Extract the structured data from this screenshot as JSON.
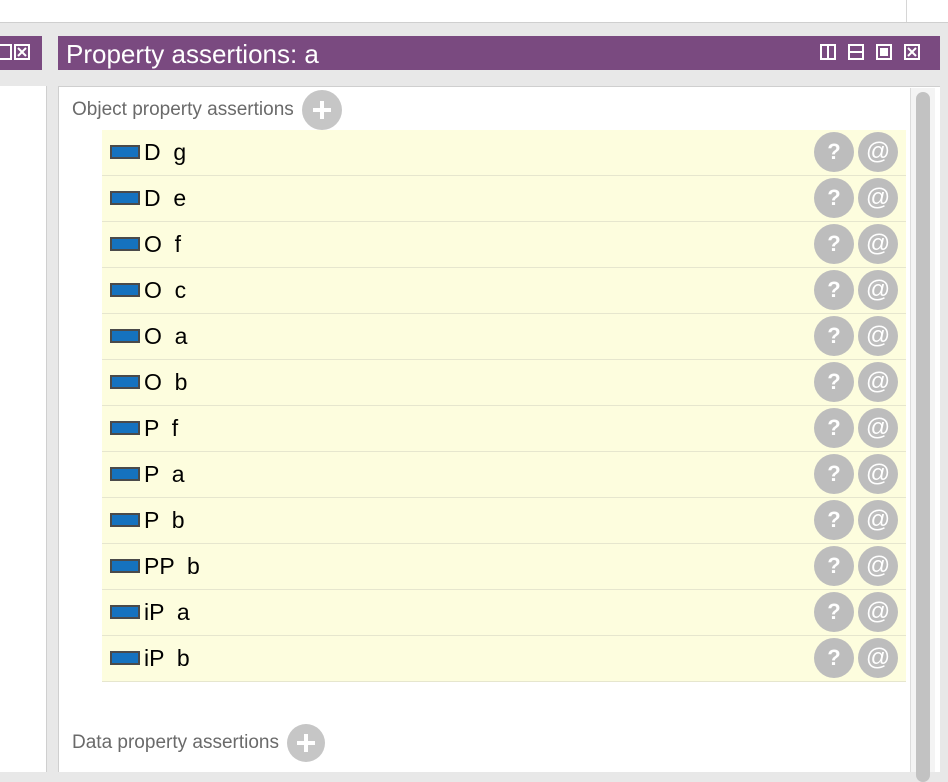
{
  "panel": {
    "title": "Property assertions: a"
  },
  "sections": {
    "object_label": "Object property assertions",
    "data_label": "Data property assertions"
  },
  "row_buttons": {
    "help": "?",
    "annotate": "@"
  },
  "assertions": [
    {
      "text": "D  g"
    },
    {
      "text": "D  e"
    },
    {
      "text": "O  f"
    },
    {
      "text": "O  c"
    },
    {
      "text": "O  a"
    },
    {
      "text": "O  b"
    },
    {
      "text": "P  f"
    },
    {
      "text": "P  a"
    },
    {
      "text": "P  b"
    },
    {
      "text": "PP  b"
    },
    {
      "text": "iP  a"
    },
    {
      "text": "iP  b"
    }
  ],
  "colors": {
    "header_purple": "#7a4a80",
    "row_background": "#fdfdde",
    "property_icon_fill": "#1572bf",
    "button_gray": "#bdbdbd"
  },
  "icons": {
    "property": "object-property-icon",
    "add": "plus-icon",
    "help": "question-icon",
    "annotate": "at-icon"
  }
}
